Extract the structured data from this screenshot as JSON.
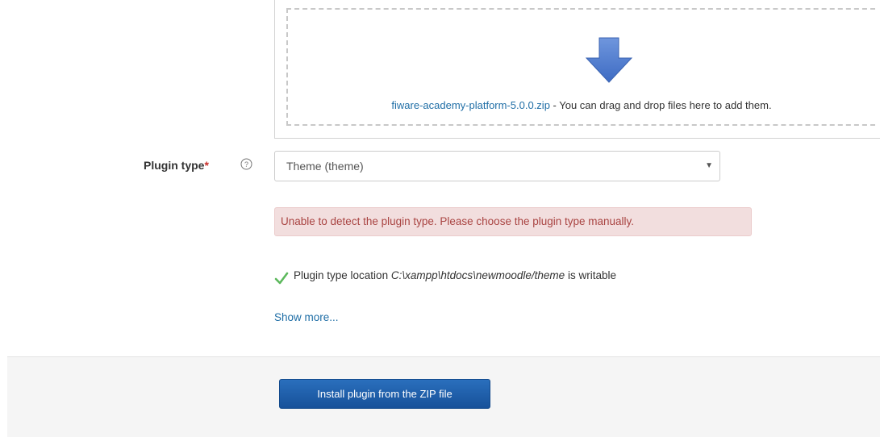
{
  "dropzone": {
    "filename": "fiware-academy-platform-5.0.0.zip",
    "hint": " - You can drag and drop files here to add them."
  },
  "plugin_type": {
    "label": "Plugin type",
    "required_marker": "*",
    "selected": "Theme (theme)"
  },
  "error": {
    "message": "Unable to detect the plugin type. Please choose the plugin type manually."
  },
  "location": {
    "prefix": "Plugin type location ",
    "path": "C:\\xampp\\htdocs\\newmoodle/theme",
    "suffix": " is writable"
  },
  "show_more": "Show more...",
  "actions": {
    "install_label": "Install plugin from the ZIP file"
  },
  "colors": {
    "link": "#1f6ea6",
    "error_bg": "#f2dede",
    "error_text": "#a94442",
    "primary_button": "#1e5fa8",
    "check": "#5cb85c",
    "arrow": "#4a7ad0"
  },
  "icons": {
    "dropzone": "down-arrow-icon",
    "help": "question-circle-icon",
    "check": "check-icon",
    "select": "caret-down-icon"
  }
}
